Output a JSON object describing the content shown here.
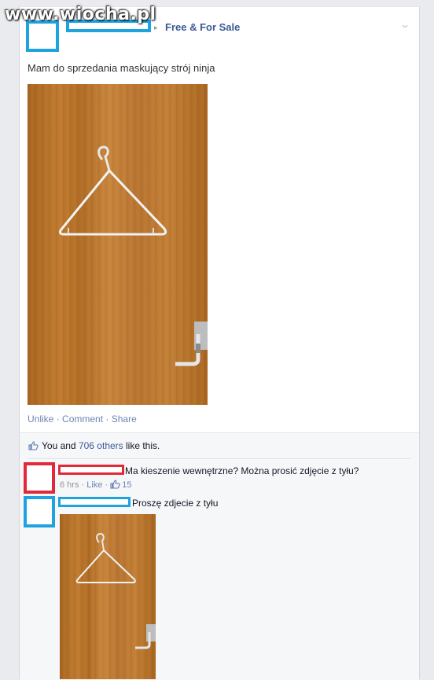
{
  "watermark": "www.wiocha.pl",
  "post": {
    "arrow": "▸",
    "group": "Free & For Sale",
    "chevron": "⌄",
    "text": "Mam do sprzedania maskujący strój ninja",
    "actions": {
      "unlike": "Unlike",
      "dot1": " · ",
      "comment": "Comment",
      "dot2": " · ",
      "share": "Share"
    }
  },
  "likes": {
    "prefix": "You and ",
    "count": "706 others",
    "suffix": " like this."
  },
  "comments": [
    {
      "text": "Ma kieszenie wewnętrzne? Można prosić zdjęcie z tyłu?",
      "time": "6 hrs",
      "sep": " · ",
      "like": "Like",
      "sep2": " · ",
      "like_count": "15"
    },
    {
      "text": "Proszę zdjecie z tyłu"
    }
  ],
  "colors": {
    "redaction_blue": "#1fa3e0",
    "redaction_red": "#e02a3a",
    "link": "#3b5998"
  }
}
